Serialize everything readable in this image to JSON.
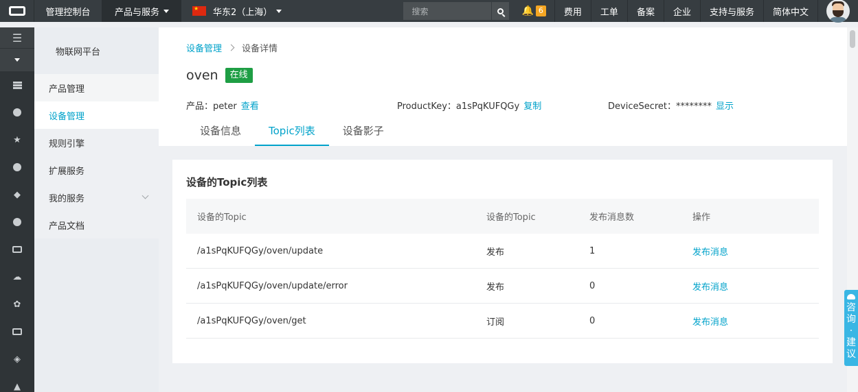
{
  "topbar": {
    "console": "管理控制台",
    "products": "产品与服务",
    "region": "华东2（上海）",
    "search_placeholder": "搜索",
    "notifications": "6",
    "links": [
      "费用",
      "工单",
      "备案",
      "企业",
      "支持与服务",
      "简体中文"
    ]
  },
  "rail": {
    "icons": [
      "menu-icon",
      "dropdown-icon",
      "storage-icon",
      "shield-icon",
      "network-icon",
      "cloud-upload-icon",
      "cube-icon",
      "cloud-icon",
      "link-icon",
      "cloud-outline-icon",
      "gear-icon",
      "link-icon",
      "layers-icon",
      "more-icon"
    ]
  },
  "sidebar": {
    "title": "物联网平台",
    "items": [
      {
        "label": "产品管理"
      },
      {
        "label": "设备管理"
      },
      {
        "label": "规则引擎"
      },
      {
        "label": "扩展服务"
      },
      {
        "label": "我的服务"
      },
      {
        "label": "产品文档"
      }
    ]
  },
  "breadcrumb": {
    "parent": "设备管理",
    "current": "设备详情"
  },
  "device": {
    "name": "oven",
    "status": "在线",
    "product_label": "产品：peter",
    "product_link": "查看",
    "productkey_label": "ProductKey：a1sPqKUFQGy",
    "productkey_link": "复制",
    "secret_label": "DeviceSecret：********",
    "secret_link": "显示"
  },
  "tabs": [
    "设备信息",
    "Topic列表",
    "设备影子"
  ],
  "topic_card": {
    "title": "设备的Topic列表",
    "columns": [
      "设备的Topic",
      "设备的Topic",
      "发布消息数",
      "操作"
    ],
    "rows": [
      {
        "topic": "/a1sPqKUFQGy/oven/update",
        "perm": "发布",
        "count": "1",
        "action": "发布消息"
      },
      {
        "topic": "/a1sPqKUFQGy/oven/update/error",
        "perm": "发布",
        "count": "0",
        "action": "发布消息"
      },
      {
        "topic": "/a1sPqKUFQGy/oven/get",
        "perm": "订阅",
        "count": "0",
        "action": "发布消息"
      }
    ]
  },
  "consult": {
    "chars": [
      "咨",
      "询",
      "·",
      "建",
      "议"
    ]
  },
  "colors": {
    "accent": "#00a2ca",
    "online": "#1e9e44",
    "topbar": "#373d41"
  }
}
